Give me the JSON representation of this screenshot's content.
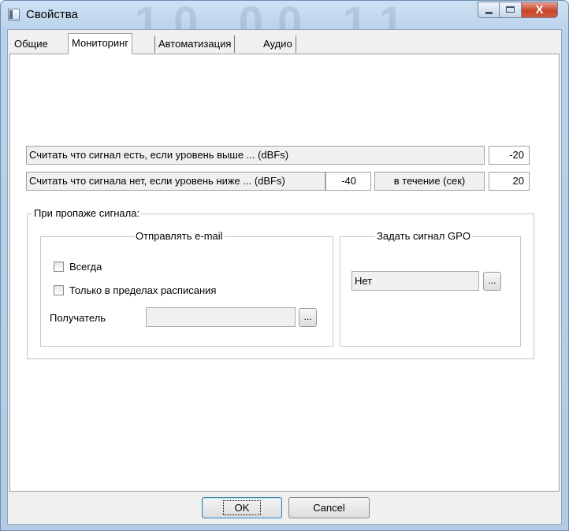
{
  "window": {
    "title": "Свойства",
    "background_ghost": "10 00 11",
    "close_label": "X"
  },
  "tabs": [
    {
      "label": "Общие",
      "active": false
    },
    {
      "label": "Мониторинг",
      "active": true
    },
    {
      "label": "Автоматизация",
      "active": false
    },
    {
      "label": "Аудио",
      "active": false
    }
  ],
  "monitoring": {
    "signal_present_label": "Считать что сигнал есть, если уровень выше ... (dBFs)",
    "signal_present_value": "-20",
    "signal_absent_label": "Считать что сигнала нет, если уровень ниже ... (dBFs)",
    "signal_absent_value": "-40",
    "duration_label": "в течение (сек)",
    "duration_value": "20"
  },
  "on_signal_loss": {
    "legend": "При пропаже сигнала:",
    "email": {
      "legend": "Отправлять e-mail",
      "always_label": "Всегда",
      "always_checked": false,
      "schedule_label": "Только в пределах расписания",
      "schedule_checked": false,
      "recipient_label": "Получатель",
      "recipient_value": "",
      "browse_label": "..."
    },
    "gpo": {
      "legend": "Задать сигнал GPO",
      "value": "Нет",
      "browse_label": "..."
    }
  },
  "buttons": {
    "ok": "OK",
    "cancel": "Cancel"
  },
  "colors": {
    "frame": "#b9d1ea",
    "close_button": "#c8452a",
    "dialog_face": "#f0f0f0"
  }
}
